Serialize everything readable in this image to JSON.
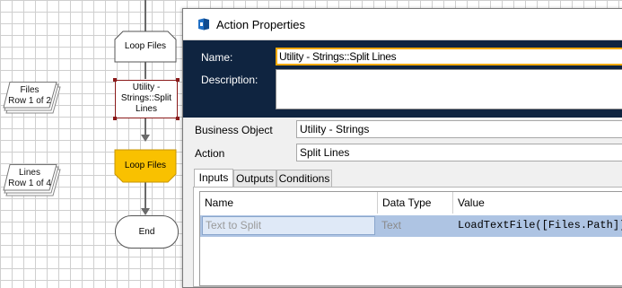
{
  "flowchart": {
    "stages": {
      "loop_top": "Loop Files",
      "action_line1": "Utility -",
      "action_line2": "Strings::Split",
      "action_line3": "Lines",
      "loop_bottom": "Loop Files",
      "end": "End"
    },
    "collections": {
      "files_name": "Files",
      "files_rows": "Row 1 of 2",
      "lines_name": "Lines",
      "lines_rows": "Row 1 of 4"
    },
    "colors": {
      "loop_fill_active": "#f9c100",
      "selection": "#8b1a1a"
    }
  },
  "dialog": {
    "title": "Action Properties",
    "name_label": "Name:",
    "name_value": "Utility - Strings::Split Lines",
    "description_label": "Description:",
    "business_object_label": "Business Object",
    "business_object_value": "Utility - Strings",
    "action_label": "Action",
    "action_value": "Split Lines",
    "tabs": [
      "Inputs",
      "Outputs",
      "Conditions"
    ],
    "active_tab": "Inputs",
    "inputs_table": {
      "columns": [
        "Name",
        "Data Type",
        "Value"
      ],
      "rows": [
        {
          "name": "Text to Split",
          "data_type": "Text",
          "value": "LoadTextFile([Files.Path])"
        }
      ]
    },
    "colors": {
      "header_bg": "#0f2440",
      "name_border": "#f2a900",
      "row_selected": "#aec4e3"
    }
  }
}
